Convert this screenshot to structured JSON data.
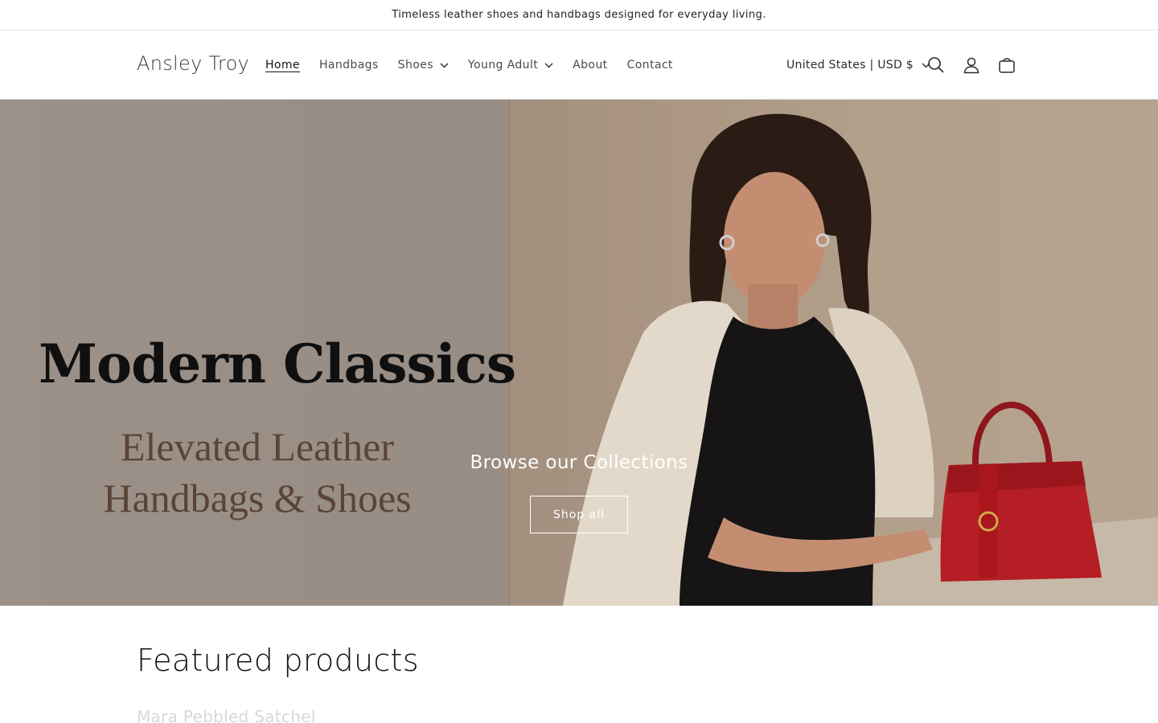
{
  "announcement": "Timeless leather shoes and handbags designed for everyday living.",
  "header": {
    "logo": "Ansley Troy",
    "nav": [
      {
        "label": "Home",
        "active": true
      },
      {
        "label": "Handbags"
      },
      {
        "label": "Shoes",
        "has_dropdown": true
      },
      {
        "label": "Young Adult",
        "has_dropdown": true
      },
      {
        "label": "About"
      },
      {
        "label": "Contact"
      }
    ],
    "localization": "United States | USD $",
    "icons": [
      "search-icon",
      "account-icon",
      "cart-icon"
    ]
  },
  "hero": {
    "title": "Modern Classics",
    "subtitle_line1": "Elevated Leather",
    "subtitle_line2": "Handbags & Shoes",
    "caption": "Browse our Collections",
    "button": "Shop all"
  },
  "featured": {
    "title": "Featured products",
    "peek": "Mara Pebbled Satchel"
  },
  "colors": {
    "text": "#121212",
    "hero_left": "#9b9189",
    "hero_right": "#b6a48f",
    "bag_red": "#b51e24",
    "dress_black": "#141414",
    "coat_cream": "#e5dccd"
  }
}
